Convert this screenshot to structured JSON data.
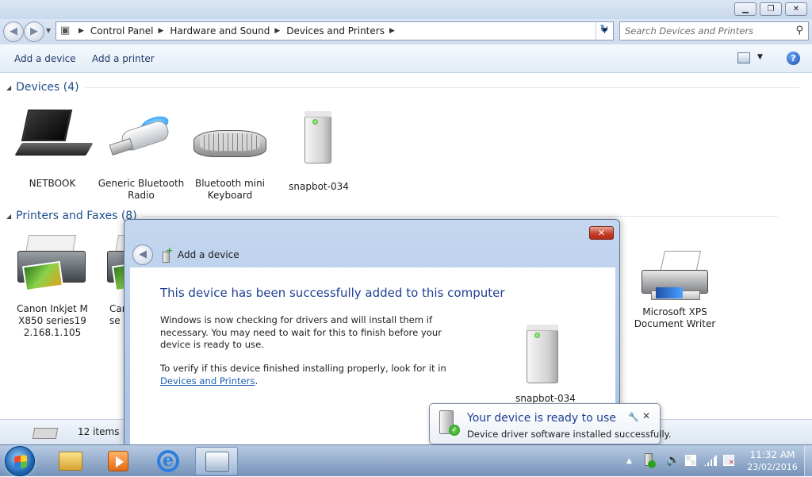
{
  "window": {
    "controls": {
      "minimize": "▁",
      "maximize": "❐",
      "close": "✕"
    }
  },
  "nav": {
    "back_glyph": "◀",
    "forward_glyph": "▶",
    "recent_glyph": "▼",
    "breadcrumb": [
      "Control Panel",
      "Hardware and Sound",
      "Devices and Printers"
    ],
    "crumb_separator": "▶",
    "address_dropdown_glyph": "▼",
    "refresh_glyph": "↻",
    "search_placeholder": "Search Devices and Printers",
    "search_icon_glyph": "⚲"
  },
  "commands": {
    "add_device": "Add a device",
    "add_printer": "Add a printer",
    "view_dropdown_glyph": "▼",
    "help_glyph": "?"
  },
  "groups": {
    "devices": {
      "title": "Devices (4)",
      "items": [
        {
          "label": "NETBOOK",
          "icon": "laptop-icon"
        },
        {
          "label": "Generic Bluetooth Radio",
          "icon": "bluetooth-adapter-icon"
        },
        {
          "label": "Bluetooth mini Keyboard",
          "icon": "keyboard-icon"
        },
        {
          "label": "snapbot-034",
          "icon": "tower-device-icon"
        }
      ]
    },
    "printers": {
      "title": "Printers and Faxes (8)",
      "items": [
        {
          "label": "Canon Inkjet MX850 series192.168.1.105",
          "icon": "printer-icon"
        },
        {
          "label": "Car\nse",
          "icon": "printer-icon"
        },
        {
          "label": "Microsoft XPS Document Writer",
          "icon": "xps-printer-icon"
        }
      ]
    },
    "collapse_glyph": "◢"
  },
  "status": {
    "count": "12 items"
  },
  "dialog": {
    "title": "Add a device",
    "close_glyph": "✕",
    "back_glyph": "◀",
    "heading": "This device has been successfully added to this computer",
    "paragraph1": "Windows is now checking for drivers and will install them if necessary. You may need to wait for this to finish before your device is ready to use.",
    "paragraph2_prefix": "To verify if this device finished installing properly, look for it in ",
    "paragraph2_link": "Devices and Printers",
    "paragraph2_suffix": ".",
    "device_label": "snapbot-034"
  },
  "balloon": {
    "title": "Your device is ready to use",
    "text": "Device driver software installed successfully.",
    "options_glyph": "🔧",
    "close_glyph": "✕"
  },
  "taskbar": {
    "tray_up_glyph": "▲",
    "volume_glyph": "🔊",
    "clock_time": "11:32 AM",
    "clock_date": "23/02/2016"
  },
  "colors": {
    "accent_link": "#1a5fb4",
    "heading_blue": "#1e3f91",
    "group_blue": "#1e4e8c",
    "close_red": "#c7402b"
  }
}
